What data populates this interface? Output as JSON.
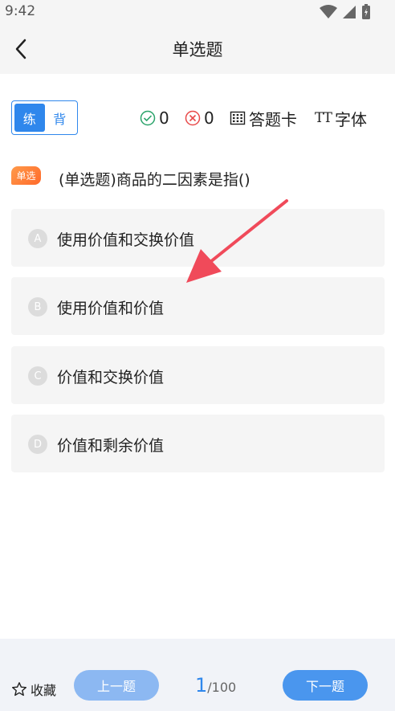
{
  "status_bar": {
    "time": "9:42"
  },
  "header": {
    "title": "单选题"
  },
  "mode_toggle": {
    "practice": "练",
    "recite": "背"
  },
  "stats": {
    "correct": "0",
    "wrong": "0",
    "answer_card": "答题卡",
    "font": "字体",
    "font_icon_text": "TT"
  },
  "question": {
    "badge": "单选",
    "text": "(单选题)商品的二因素是指()",
    "options": [
      {
        "letter": "A",
        "text": "使用价值和交换价值"
      },
      {
        "letter": "B",
        "text": "使用价值和价值"
      },
      {
        "letter": "C",
        "text": "价值和交换价值"
      },
      {
        "letter": "D",
        "text": "价值和剩余价值"
      }
    ]
  },
  "footer": {
    "favorite": "收藏",
    "prev": "上一题",
    "next": "下一题",
    "current_page": "1",
    "total_pages": "/100"
  },
  "colors": {
    "accent": "#2f87ec",
    "badge": "#ff7a35",
    "arrow": "#f04a5a",
    "wrong": "#e84a4a",
    "correct": "#2aa36a"
  }
}
